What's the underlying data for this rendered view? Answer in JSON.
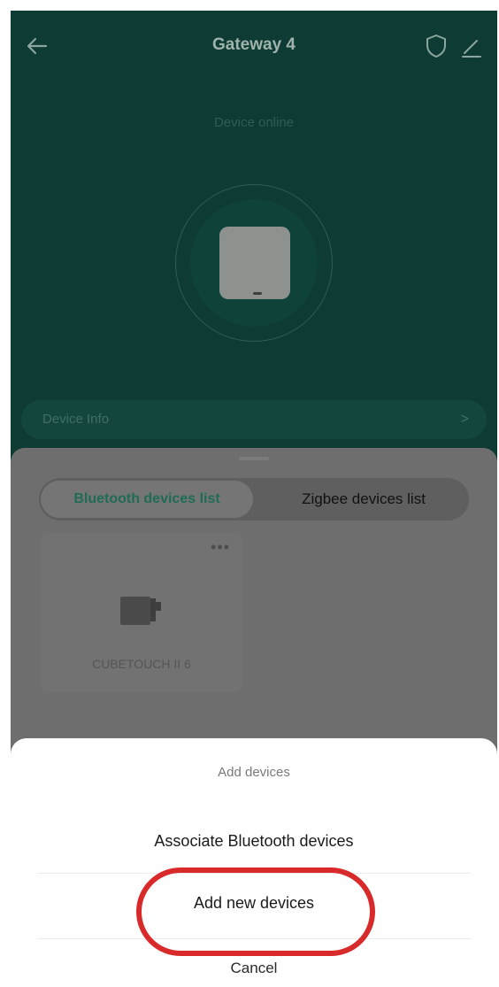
{
  "header": {
    "title": "Gateway 4"
  },
  "status": "Device online",
  "device_info": {
    "label": "Device Info",
    "chevron": ">"
  },
  "tabs": [
    {
      "label": "Bluetooth devices list",
      "active": true
    },
    {
      "label": "Zigbee devices list",
      "active": false
    }
  ],
  "device_card": {
    "name": "CUBETOUCH II 6",
    "more": "•••"
  },
  "add_sheet": {
    "title": "Add devices",
    "options": [
      {
        "label": "Associate Bluetooth devices"
      },
      {
        "label": "Add new devices",
        "highlighted": true
      }
    ],
    "cancel": "Cancel"
  },
  "colors": {
    "header_bg": "#0e3b33",
    "overlay_gray": "#6e6e6e",
    "highlight_ring": "#d82a2a",
    "active_tab_text": "#1f6b56"
  }
}
